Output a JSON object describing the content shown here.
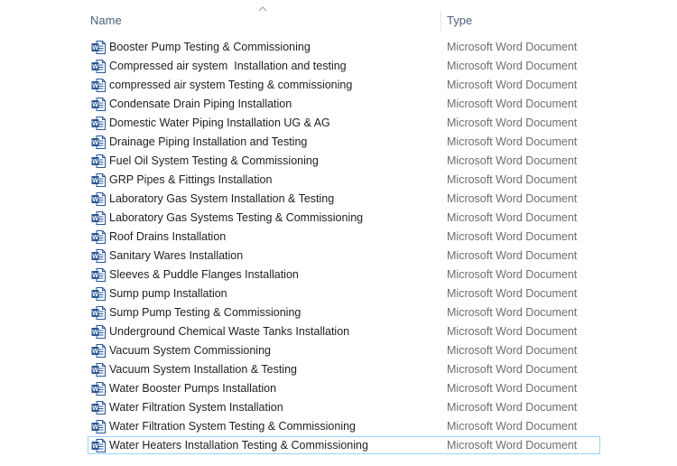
{
  "header": {
    "name_label": "Name",
    "type_label": "Type",
    "sort_direction": "ascending"
  },
  "colors": {
    "header_text": "#4c607a",
    "name_text": "#1e1e1e",
    "type_text": "#6d6d6d",
    "focus_border": "#99d1ff",
    "word_icon": "#2b579a"
  },
  "icons": {
    "file_icon": "word-document-icon",
    "word_letter": "W"
  },
  "files": [
    {
      "name": "Booster Pump Testing & Commissioning",
      "type": "Microsoft Word Document"
    },
    {
      "name": "Compressed air system  Installation and testing",
      "type": "Microsoft Word Document"
    },
    {
      "name": "compressed air system Testing & commissioning",
      "type": "Microsoft Word Document"
    },
    {
      "name": "Condensate Drain Piping Installation",
      "type": "Microsoft Word Document"
    },
    {
      "name": "Domestic Water Piping Installation UG & AG",
      "type": "Microsoft Word Document"
    },
    {
      "name": "Drainage Piping Installation and Testing",
      "type": "Microsoft Word Document"
    },
    {
      "name": "Fuel Oil System Testing & Commissioning",
      "type": "Microsoft Word Document"
    },
    {
      "name": "GRP Pipes & Fittings Installation",
      "type": "Microsoft Word Document"
    },
    {
      "name": "Laboratory Gas System Installation & Testing",
      "type": "Microsoft Word Document"
    },
    {
      "name": "Laboratory Gas Systems Testing & Commissioning",
      "type": "Microsoft Word Document"
    },
    {
      "name": "Roof Drains Installation",
      "type": "Microsoft Word Document"
    },
    {
      "name": "Sanitary Wares Installation",
      "type": "Microsoft Word Document"
    },
    {
      "name": "Sleeves & Puddle Flanges Installation",
      "type": "Microsoft Word Document"
    },
    {
      "name": "Sump pump Installation",
      "type": "Microsoft Word Document"
    },
    {
      "name": "Sump Pump Testing & Commissioning",
      "type": "Microsoft Word Document"
    },
    {
      "name": "Underground Chemical Waste Tanks Installation",
      "type": "Microsoft Word Document"
    },
    {
      "name": "Vacuum System Commissioning",
      "type": "Microsoft Word Document"
    },
    {
      "name": "Vacuum System Installation & Testing",
      "type": "Microsoft Word Document"
    },
    {
      "name": "Water Booster Pumps Installation",
      "type": "Microsoft Word Document"
    },
    {
      "name": "Water Filtration System Installation",
      "type": "Microsoft Word Document"
    },
    {
      "name": "Water Filtration System Testing & Commissioning",
      "type": "Microsoft Word Document"
    },
    {
      "name": "Water Heaters Installation Testing & Commissioning",
      "type": "Microsoft Word Document",
      "focused": true
    }
  ]
}
